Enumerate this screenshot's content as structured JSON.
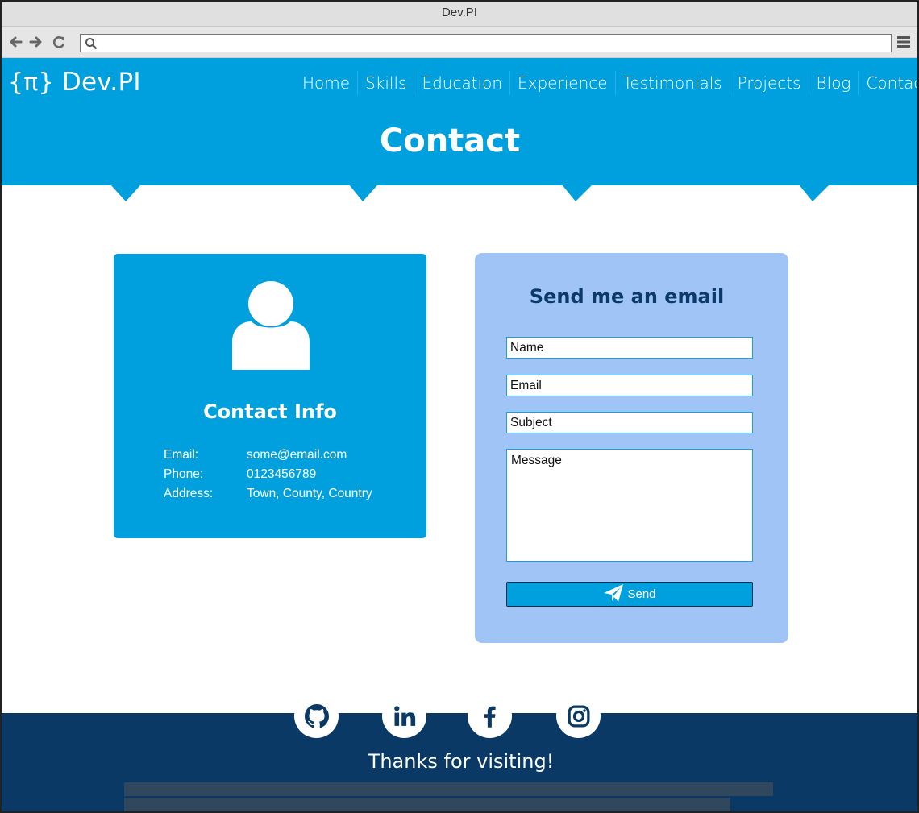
{
  "browser": {
    "title": "Dev.PI",
    "address": ""
  },
  "header": {
    "logo_brace": "{π}",
    "logo_text": "Dev.PI",
    "nav": [
      "Home",
      "Skills",
      "Education",
      "Experience",
      "Testimonials",
      "Projects",
      "Blog",
      "Contact"
    ],
    "page_title": "Contact",
    "color": "#00a0df"
  },
  "contact_info": {
    "title": "Contact Info",
    "rows": [
      {
        "label": "Email:",
        "value": "some@email.com"
      },
      {
        "label": "Phone:",
        "value": "0123456789"
      },
      {
        "label": "Address:",
        "value": "Town, County, Country"
      }
    ]
  },
  "email_form": {
    "title": "Send me an email",
    "name_placeholder": "Name",
    "email_placeholder": "Email",
    "subject_placeholder": "Subject",
    "message_placeholder": "Message",
    "send_label": "Send",
    "color": "#a0c4f6"
  },
  "footer": {
    "social": [
      "github-icon",
      "linkedin-icon",
      "facebook-icon",
      "instagram-icon"
    ],
    "thanks": "Thanks for visiting!",
    "color": "#0a3966"
  }
}
